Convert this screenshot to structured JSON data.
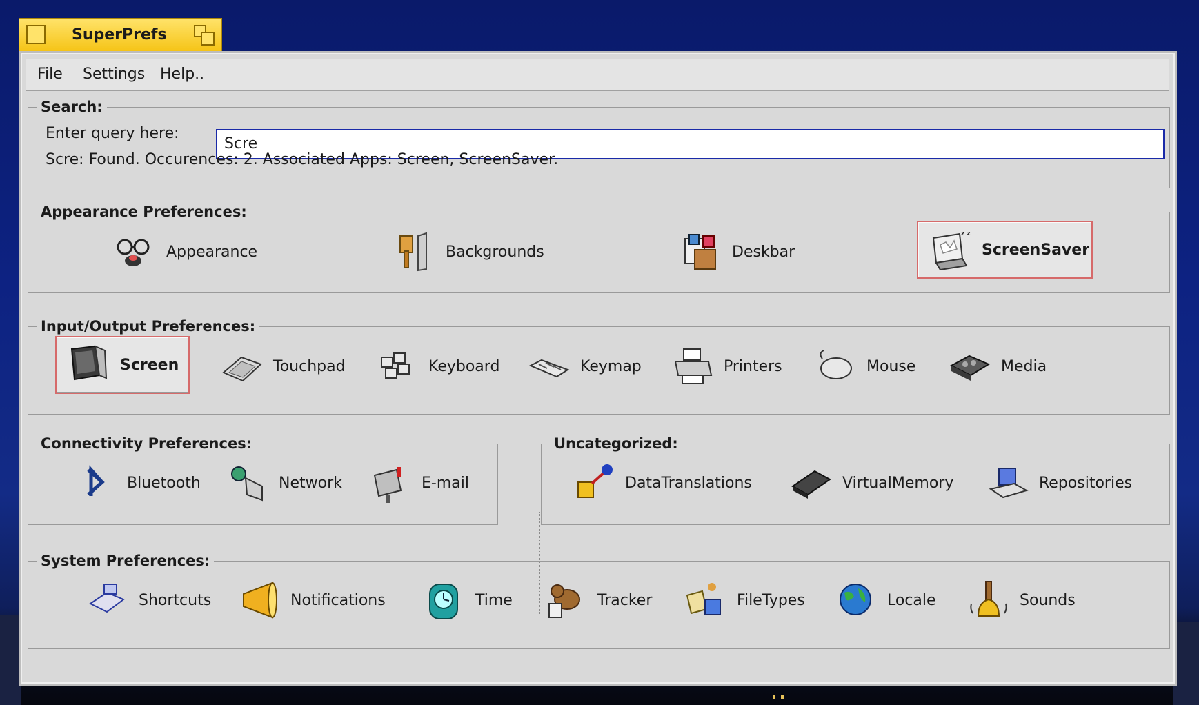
{
  "window": {
    "title": "SuperPrefs"
  },
  "menu": {
    "items": [
      "File",
      "Settings",
      "Help.."
    ]
  },
  "search": {
    "label": "Search:",
    "prompt": "Enter query here:",
    "value": "Scre",
    "result": "Scre: Found. Occurences: 2. Associated Apps: Screen, ScreenSaver."
  },
  "groups": {
    "appearance": {
      "label": "Appearance Preferences:",
      "items": [
        {
          "label": "Appearance",
          "icon": "appearance-icon"
        },
        {
          "label": "Backgrounds",
          "icon": "backgrounds-icon"
        },
        {
          "label": "Deskbar",
          "icon": "deskbar-icon"
        },
        {
          "label": "ScreenSaver",
          "icon": "screensaver-icon",
          "highlighted": true
        }
      ]
    },
    "io": {
      "label": "Input/Output Preferences:",
      "items": [
        {
          "label": "Screen",
          "icon": "screen-icon",
          "highlighted": true
        },
        {
          "label": "Touchpad",
          "icon": "touchpad-icon"
        },
        {
          "label": "Keyboard",
          "icon": "keyboard-icon"
        },
        {
          "label": "Keymap",
          "icon": "keymap-icon"
        },
        {
          "label": "Printers",
          "icon": "printer-icon"
        },
        {
          "label": "Mouse",
          "icon": "mouse-icon"
        },
        {
          "label": "Media",
          "icon": "media-icon"
        }
      ]
    },
    "connectivity": {
      "label": "Connectivity Preferences:",
      "items": [
        {
          "label": "Bluetooth",
          "icon": "bluetooth-icon"
        },
        {
          "label": "Network",
          "icon": "network-icon"
        },
        {
          "label": "E-mail",
          "icon": "email-icon"
        }
      ]
    },
    "uncategorized": {
      "label": "Uncategorized:",
      "items": [
        {
          "label": "DataTranslations",
          "icon": "datatranslations-icon"
        },
        {
          "label": "VirtualMemory",
          "icon": "virtualmemory-icon"
        },
        {
          "label": "Repositories",
          "icon": "repositories-icon"
        }
      ]
    },
    "system": {
      "label": "System Preferences:",
      "items": [
        {
          "label": "Shortcuts",
          "icon": "shortcuts-icon"
        },
        {
          "label": "Notifications",
          "icon": "notifications-icon"
        },
        {
          "label": "Time",
          "icon": "time-icon"
        },
        {
          "label": "Tracker",
          "icon": "tracker-icon"
        },
        {
          "label": "FileTypes",
          "icon": "filetypes-icon"
        },
        {
          "label": "Locale",
          "icon": "locale-icon"
        },
        {
          "label": "Sounds",
          "icon": "sounds-icon"
        }
      ]
    }
  },
  "colors": {
    "titlebar": "#f5c417",
    "window_bg": "#d9d9d9",
    "highlight_border": "#d66a6a",
    "search_border": "#1a2aa8"
  }
}
